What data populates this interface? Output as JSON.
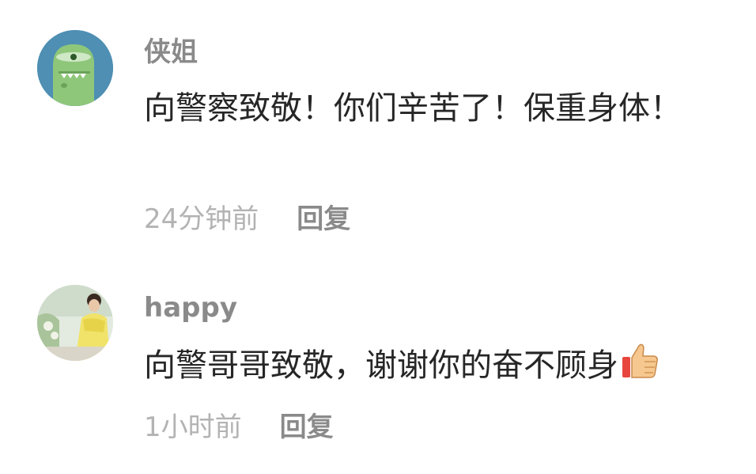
{
  "comments": [
    {
      "username": "侠姐",
      "content": "向警察致敬！你们辛苦了！保重身体！",
      "timestamp": "24分钟前",
      "reply_label": "回复",
      "avatar_icon": "green-dinosaur-avatar"
    },
    {
      "username": "happy",
      "content": "向警哥哥致敬，谢谢你的奋不顾身",
      "emoji": "thumbs-up-icon",
      "timestamp": "1小时前",
      "reply_label": "回复",
      "avatar_icon": "photo-avatar"
    }
  ],
  "colors": {
    "username": "#8a8a8a",
    "content": "#262626",
    "timestamp": "#b3b3b3",
    "reply": "#8a8a8a",
    "avatar1_bg": "#4e8fb3",
    "avatar1_fg": "#8fc77a"
  }
}
